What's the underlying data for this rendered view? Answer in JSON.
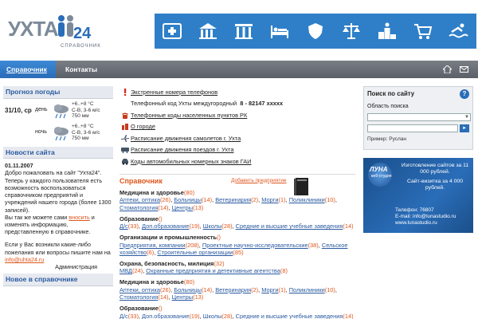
{
  "header": {
    "logo_text": "УХТА",
    "logo_num": "24",
    "logo_sub": "СПРАВОЧНИК",
    "icons": [
      "medical-icon",
      "building-icon",
      "columns-icon",
      "hotel-bed-icon",
      "shield-icon",
      "scales-icon",
      "podium-icon",
      "cart-icon",
      "swimmer-icon"
    ]
  },
  "nav": {
    "tabs": [
      {
        "label": "Справочник"
      },
      {
        "label": "Контакты"
      }
    ],
    "icons": [
      "home-icon",
      "mail-icon"
    ]
  },
  "weather": {
    "title": "Прогноз погоды",
    "date": "31/10, ср",
    "rows": [
      {
        "part": "день",
        "t": "+6..+8 °С",
        "wind": "С-В, 3-6 м/с",
        "p": "750 мм"
      },
      {
        "part": "ночь",
        "t": "+6..+8 °С",
        "wind": "С-В, 3-6 м/с",
        "p": "750 мм"
      }
    ]
  },
  "news": {
    "title": "Новости сайта",
    "date": "01.11.2007",
    "p1": "Добро пожаловать на сайт  \"Ухта24\". Теперь у каждого пользователя есть возможность воспользоваться справочником предприятий и учреждений нашего города (более 1300 записей).",
    "p2a": "Вы так же можете сами ",
    "p2link": "вносить",
    "p2b": " и изменять информацию, представленную в справочнике.",
    "p3a": "Если у Вас возникли какие-либо пожелания или вопросы пишите нам на ",
    "p3link": "info@uhta24.ru",
    "admin": "Администрация",
    "new_title": "Новое в справочнике"
  },
  "middle": {
    "emergency": "Экстренные номера телефонов",
    "phone_label": "Телефонный код Ухты междугородный",
    "phone_value": "8 - 82147 xxxxx",
    "codes": "Телефонные коды населенных пунктов РК",
    "city": "О городе",
    "flights": "Расписание движения самолетов г. Ухта",
    "trains": "Расписание движения поездов г. Ухта",
    "cars": "Коды автомобильных номерных знаков ГАИ"
  },
  "sprav": {
    "title": "Справочник",
    "add": "Добавить предприятие",
    "cats": [
      {
        "name": "Медицина и здоровье",
        "count": "(80)",
        "items": [
          [
            "Аптеки, оптика",
            "(26)"
          ],
          [
            "Больницы",
            "(14)"
          ],
          [
            "Ветеринария",
            "(2)"
          ],
          [
            "Морги",
            "(1)"
          ],
          [
            "Поликлиники",
            "(10)"
          ],
          [
            "Стоматология",
            "(14)"
          ],
          [
            "Центры",
            "(13)"
          ]
        ]
      },
      {
        "name": "Образование",
        "count": "()",
        "items": [
          [
            "Д/с",
            "(33)"
          ],
          [
            "Доп.образование",
            "(19)"
          ],
          [
            "Школы",
            "(28)"
          ],
          [
            "Средние и высшие учебные заведения",
            "(14)"
          ]
        ]
      },
      {
        "name": "Организации и промышленность",
        "count": "()",
        "items": [
          [
            "Предприятия, компании",
            "(208)"
          ],
          [
            "Проектные научно-исследовательские",
            "(38)"
          ],
          [
            "Сельское хозяйство",
            "(6)"
          ],
          [
            "Строительные организации",
            "(85)"
          ]
        ]
      },
      {
        "name": "Охрана, безопасность, милиция",
        "count": "(32)",
        "items": [
          [
            "МВД",
            "(24)"
          ],
          [
            "Охранные предприятия и детективные агентства",
            "(8)"
          ]
        ]
      },
      {
        "name": "Медицина и здоровье",
        "count": "(80)",
        "items": [
          [
            "Аптеки, оптика",
            "(26)"
          ],
          [
            "Больницы",
            "(14)"
          ],
          [
            "Ветеринария",
            "(2)"
          ],
          [
            "Морги",
            "(1)"
          ],
          [
            "Поликлиники",
            "(10)"
          ],
          [
            "Стоматология",
            "(14)"
          ],
          [
            "Центры",
            "(13)"
          ]
        ]
      },
      {
        "name": "Образование",
        "count": "()",
        "items": [
          [
            "Д/с",
            "(33)"
          ],
          [
            "Доп.образование",
            "(19)"
          ],
          [
            "Школы",
            "(28)"
          ],
          [
            "Средние и высшие учебные заведения",
            "(14)"
          ]
        ]
      }
    ]
  },
  "search": {
    "title": "Поиск по сайту",
    "help": "?",
    "area_label": "Область поиска",
    "go": "►",
    "example": "Пример: Руслан"
  },
  "banner": {
    "name": "ЛУНА",
    "studio": "веб-студия",
    "line1": "Изготовление сайтов за 11 000 рублей.",
    "line2": "Сайт-визитка за 4 000 рублей.",
    "phone": "Телефон: 76807",
    "email": "E-mail: info@lunastudio.ru",
    "site": "www.lunastudio.ru"
  }
}
